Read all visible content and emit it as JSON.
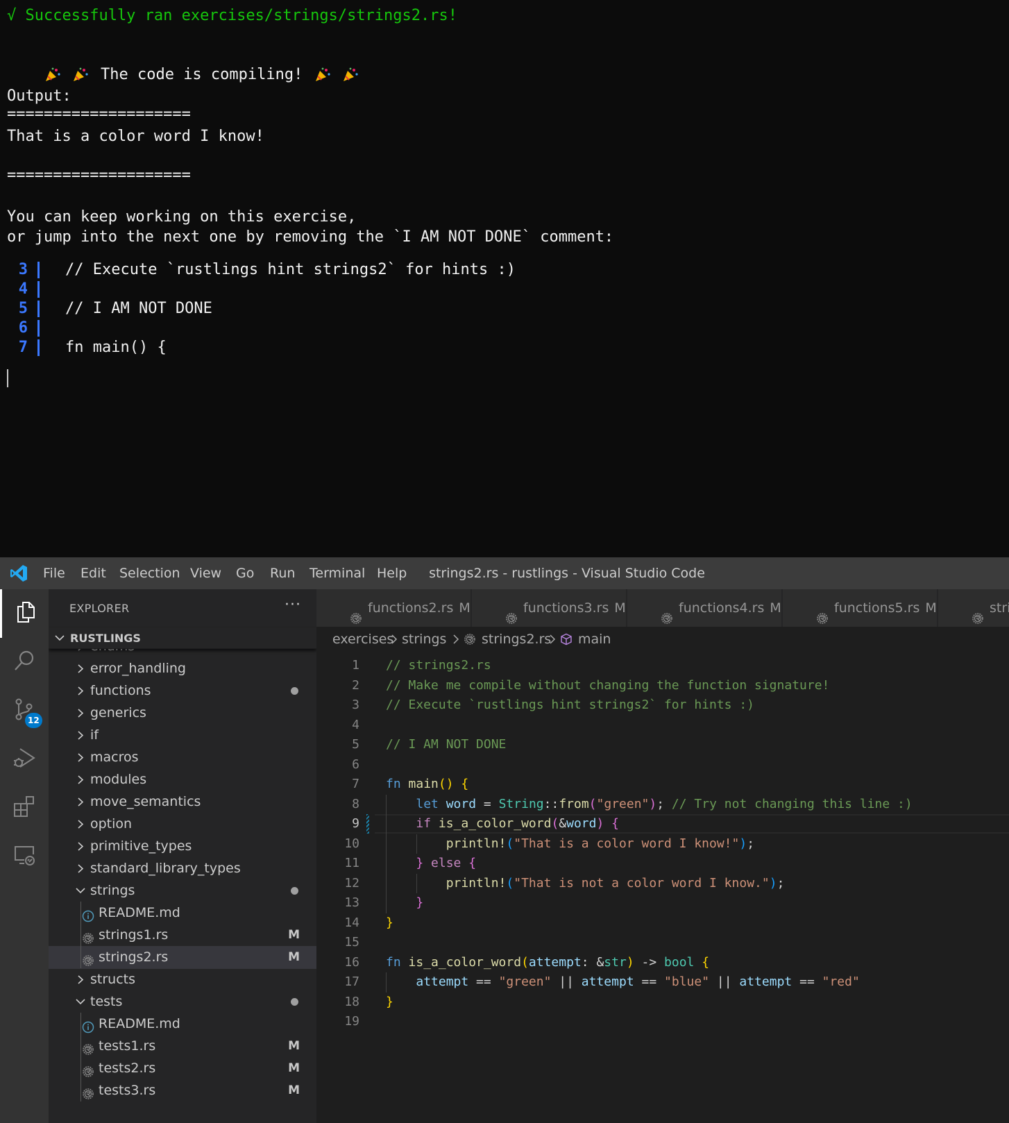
{
  "terminal": {
    "success_line": "√ Successfully ran exercises/strings/strings2.rs!",
    "compiling_line": "The code is compiling!",
    "output_label": "Output:",
    "separator": "====================",
    "program_output": "That is a color word I know!",
    "keep_working": "You can keep working on this exercise,",
    "jump_next": "or jump into the next one by removing the `I AM NOT DONE` comment:",
    "snippet": [
      {
        "num": "3",
        "code": "// Execute `rustlings hint strings2` for hints :)"
      },
      {
        "num": "4",
        "code": ""
      },
      {
        "num": "5",
        "code": "// I AM NOT DONE"
      },
      {
        "num": "6",
        "code": ""
      },
      {
        "num": "7",
        "code": "fn main() {"
      }
    ]
  },
  "titlebar": {
    "menu": [
      "File",
      "Edit",
      "Selection",
      "View",
      "Go",
      "Run",
      "Terminal",
      "Help"
    ],
    "window_title": "strings2.rs - rustlings - Visual Studio Code"
  },
  "activity": {
    "scm_badge": "12"
  },
  "sidebar": {
    "title": "EXPLORER",
    "more": "···",
    "section": "RUSTLINGS",
    "items": [
      {
        "name": "enums",
        "type": "folder",
        "open": false,
        "level": 1
      },
      {
        "name": "error_handling",
        "type": "folder",
        "open": false,
        "level": 1
      },
      {
        "name": "functions",
        "type": "folder",
        "open": false,
        "level": 1,
        "dot": true
      },
      {
        "name": "generics",
        "type": "folder",
        "open": false,
        "level": 1
      },
      {
        "name": "if",
        "type": "folder",
        "open": false,
        "level": 1
      },
      {
        "name": "macros",
        "type": "folder",
        "open": false,
        "level": 1
      },
      {
        "name": "modules",
        "type": "folder",
        "open": false,
        "level": 1
      },
      {
        "name": "move_semantics",
        "type": "folder",
        "open": false,
        "level": 1
      },
      {
        "name": "option",
        "type": "folder",
        "open": false,
        "level": 1
      },
      {
        "name": "primitive_types",
        "type": "folder",
        "open": false,
        "level": 1
      },
      {
        "name": "standard_library_types",
        "type": "folder",
        "open": false,
        "level": 1
      },
      {
        "name": "strings",
        "type": "folder",
        "open": true,
        "level": 1,
        "dot": true
      },
      {
        "name": "README.md",
        "type": "info",
        "level": 2
      },
      {
        "name": "strings1.rs",
        "type": "rust",
        "level": 2,
        "mod": "M"
      },
      {
        "name": "strings2.rs",
        "type": "rust",
        "level": 2,
        "mod": "M",
        "selected": true
      },
      {
        "name": "structs",
        "type": "folder",
        "open": false,
        "level": 1
      },
      {
        "name": "tests",
        "type": "folder",
        "open": true,
        "level": 1,
        "dot": true
      },
      {
        "name": "README.md",
        "type": "info",
        "level": 2
      },
      {
        "name": "tests1.rs",
        "type": "rust",
        "level": 2,
        "mod": "M"
      },
      {
        "name": "tests2.rs",
        "type": "rust",
        "level": 2,
        "mod": "M"
      },
      {
        "name": "tests3.rs",
        "type": "rust",
        "level": 2,
        "mod": "M"
      }
    ]
  },
  "tabs": [
    {
      "name": "functions2.rs",
      "mod": "M"
    },
    {
      "name": "functions3.rs",
      "mod": "M"
    },
    {
      "name": "functions4.rs",
      "mod": "M"
    },
    {
      "name": "functions5.rs",
      "mod": "M"
    },
    {
      "name": "stri",
      "mod": ""
    }
  ],
  "breadcrumb": [
    "exercises",
    "strings",
    "strings2.rs",
    "main"
  ],
  "editor": {
    "current_line": 9,
    "line_numbers": [
      "1",
      "2",
      "3",
      "4",
      "5",
      "6",
      "7",
      "8",
      "9",
      "10",
      "11",
      "12",
      "13",
      "14",
      "15",
      "16",
      "17",
      "18",
      "19"
    ]
  },
  "colors": {
    "terminal_green": "#16c60c",
    "terminal_blue": "#3b78ff",
    "vscode_accent": "#007acc",
    "comment": "#6a9955",
    "keyword": "#569cd6",
    "string": "#ce9178"
  }
}
